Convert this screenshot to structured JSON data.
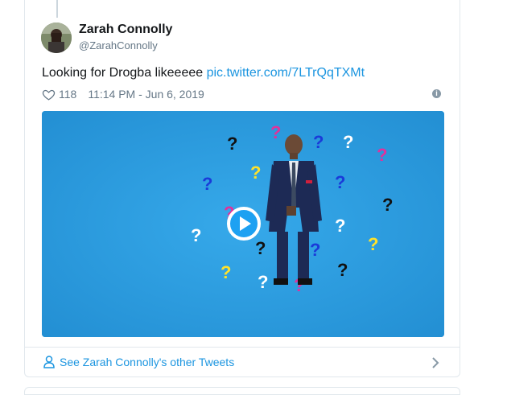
{
  "tweet": {
    "author_name": "Zarah Connolly",
    "author_handle": "@ZarahConnolly",
    "text": "Looking for Drogba likeeeee ",
    "link": "pic.twitter.com/7LTrQqTXMt",
    "like_count": "118",
    "timestamp": "11:14 PM - Jun 6, 2019"
  },
  "footer": {
    "label": "See Zarah Connolly's other Tweets"
  },
  "colors": {
    "link": "#1b95e0",
    "muted": "#657786",
    "border": "#e1e8ed",
    "media_bg": "#2a9ee0"
  },
  "icons": {
    "like": "heart-icon",
    "info": "info-icon",
    "play": "play-icon",
    "footer": "person-icon",
    "chevron": "chevron-right-icon"
  }
}
